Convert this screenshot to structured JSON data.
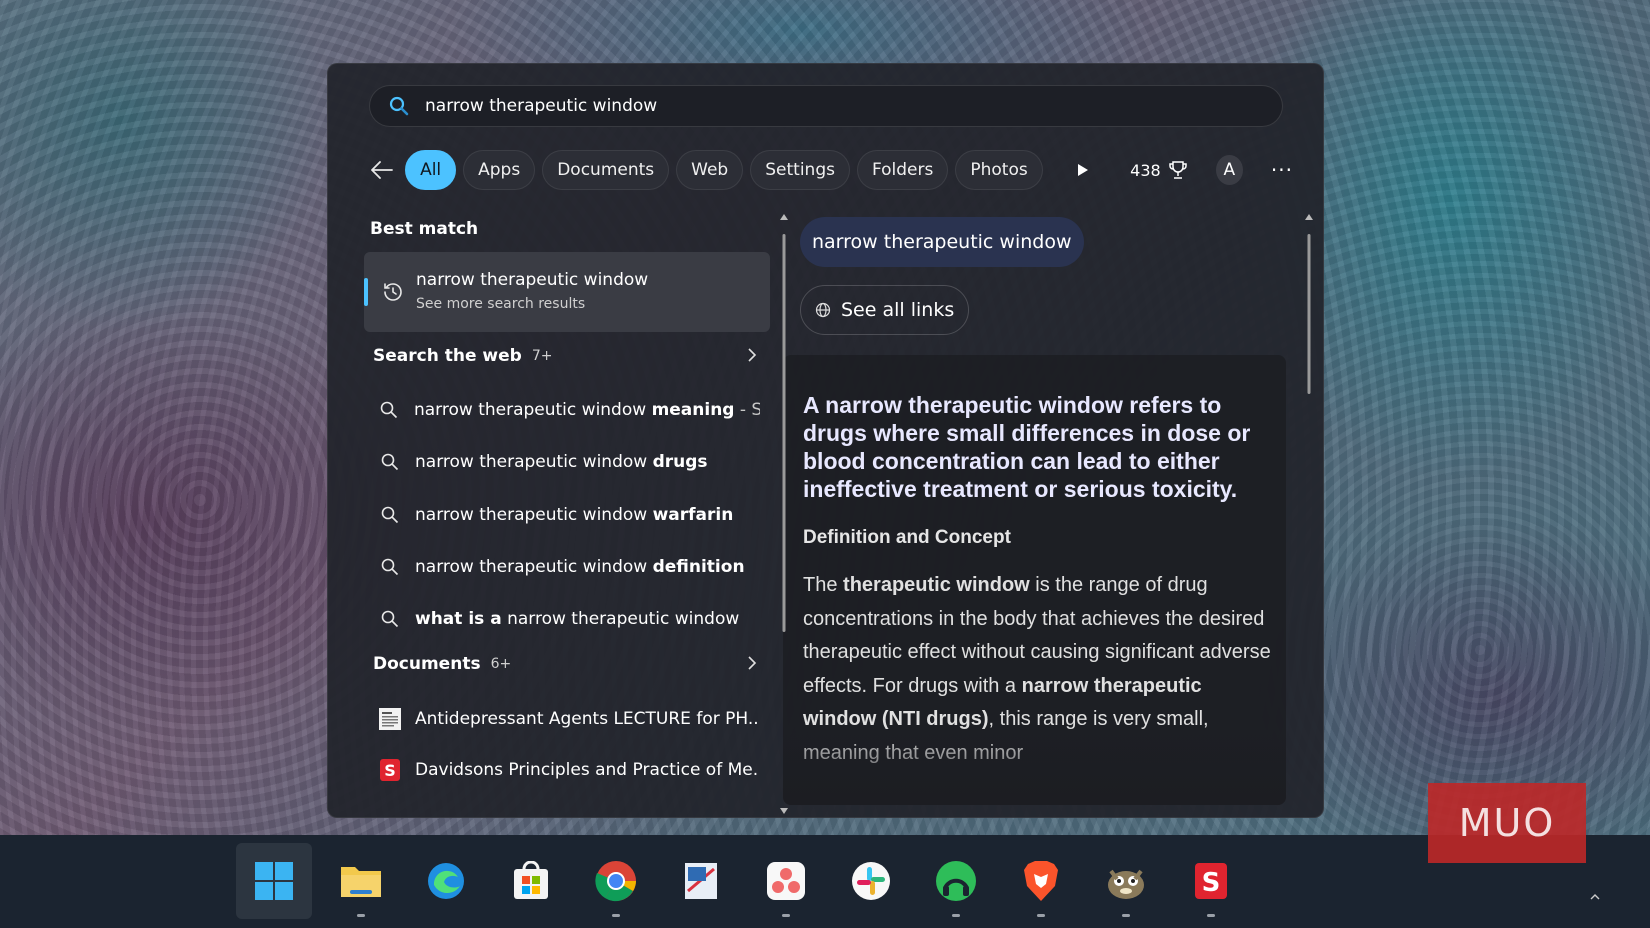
{
  "search": {
    "query": "narrow therapeutic window"
  },
  "filters": {
    "items": [
      {
        "label": "All",
        "active": true
      },
      {
        "label": "Apps",
        "active": false
      },
      {
        "label": "Documents",
        "active": false
      },
      {
        "label": "Web",
        "active": false
      },
      {
        "label": "Settings",
        "active": false
      },
      {
        "label": "Folders",
        "active": false
      },
      {
        "label": "Photos",
        "active": false
      }
    ],
    "points": "438",
    "avatar": "A",
    "more": "···"
  },
  "best_match": {
    "heading": "Best match",
    "title": "narrow therapeutic window",
    "subtitle": "See more search results"
  },
  "search_web": {
    "heading": "Search the web",
    "count": "7+",
    "results": [
      {
        "prefix": "narrow therapeutic window ",
        "bold": "meaning",
        "suffix": " - S..."
      },
      {
        "prefix": "narrow therapeutic window ",
        "bold": "drugs",
        "suffix": ""
      },
      {
        "prefix": "narrow therapeutic window ",
        "bold": "warfarin",
        "suffix": ""
      },
      {
        "prefix": "narrow therapeutic window ",
        "bold": "definition",
        "suffix": ""
      },
      {
        "prefix": "",
        "bold": "what is a",
        "suffix": " narrow therapeutic window"
      }
    ]
  },
  "documents": {
    "heading": "Documents",
    "count": "6+",
    "items": [
      {
        "title": "Antidepressant Agents LECTURE for PH..."
      },
      {
        "title": "Davidsons Principles and Practice of Me..."
      }
    ]
  },
  "preview": {
    "query_chip": "narrow therapeutic window",
    "links_button": "See all links",
    "headline": "A narrow therapeutic window refers to drugs where small differences in dose or blood concentration can lead to either ineffective treatment or serious toxicity.",
    "subhead": "Definition and Concept",
    "body_1": "The ",
    "body_bold_1": "therapeutic window",
    "body_2": " is the range of drug concentrations in the body that achieves the desired therapeutic effect without causing significant adverse effects. For drugs with a ",
    "body_bold_2": "narrow therapeutic window (NTI drugs)",
    "body_3": ", this range is very small, meaning that even minor"
  },
  "watermark": {
    "text": "MUO"
  },
  "colors": {
    "accent": "#4cc2ff",
    "panel": "#22242c",
    "taskbar": "#1b2430"
  },
  "taskbar": {
    "icons": [
      "windows-start-icon",
      "file-explorer-icon",
      "edge-icon",
      "store-icon",
      "chrome-icon",
      "snipping-tool-icon",
      "asana-icon",
      "slack-icon",
      "spotify-icon",
      "brave-icon",
      "gimp-icon",
      "docs-s-icon"
    ]
  }
}
